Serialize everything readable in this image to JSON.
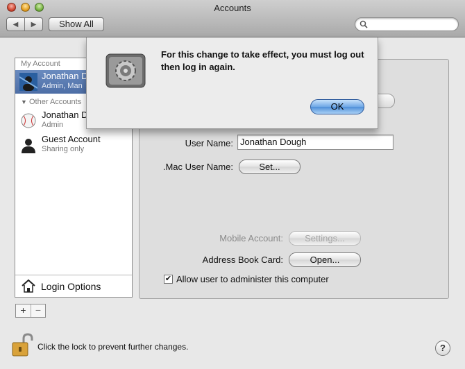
{
  "window": {
    "title": "Accounts"
  },
  "toolbar": {
    "back_icon": "◀",
    "forward_icon": "▶",
    "show_all_label": "Show All",
    "search_icon": "search-icon"
  },
  "sidebar": {
    "my_account_header": "My Account",
    "other_accounts_header": "Other Accounts",
    "accounts": [
      {
        "name": "Jonathan D",
        "role": "Admin, Man",
        "selected": true
      },
      {
        "name": "Jonathan D",
        "role": "Admin"
      },
      {
        "name": "Guest Account",
        "role": "Sharing only"
      }
    ],
    "login_options_label": "Login Options",
    "add_label": "+",
    "remove_label": "−"
  },
  "panel": {
    "user_name_label": "User Name:",
    "user_name_value": "Jonathan Dough",
    "mac_user_name_label": ".Mac User Name:",
    "set_button_label": "Set...",
    "mobile_account_label": "Mobile Account:",
    "settings_button_label": "Settings...",
    "address_book_label": "Address Book Card:",
    "open_button_label": "Open...",
    "allow_admin_label": "Allow user to administer this computer",
    "allow_admin_checked": "✔"
  },
  "footer": {
    "lock_text": "Click the lock to prevent further changes.",
    "help_label": "?"
  },
  "dialog": {
    "message": "For this change to take effect, you must log out then log in again.",
    "ok_label": "OK"
  }
}
